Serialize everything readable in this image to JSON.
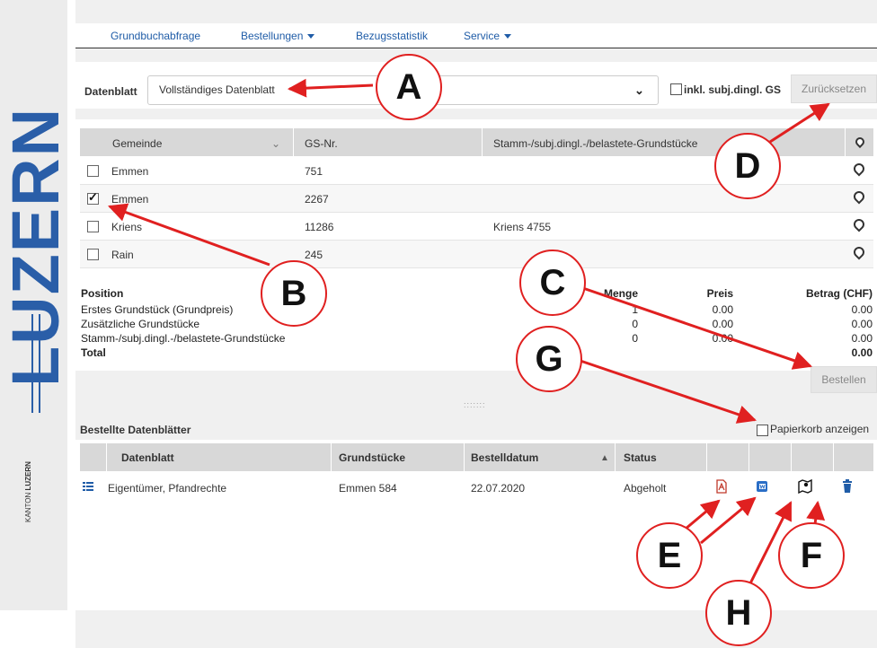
{
  "brand": {
    "word": "LUZERN",
    "small_top": "KANTON",
    "small_bottom": "LUZERN"
  },
  "nav": {
    "items": [
      {
        "label": "Grundbuchabfrage",
        "dropdown": false
      },
      {
        "label": "Bestellungen",
        "dropdown": true
      },
      {
        "label": "Bezugsstatistik",
        "dropdown": false
      },
      {
        "label": "Service",
        "dropdown": true
      }
    ]
  },
  "datenblatt": {
    "label": "Datenblatt",
    "selected": "Vollständiges Datenblatt",
    "checkbox_label": "inkl. subj.dingl. GS",
    "checkbox_checked": false,
    "reset_label": "Zurücksetzen"
  },
  "grundstuecke": {
    "columns": [
      "Gemeinde",
      "GS-Nr.",
      "Stamm-/subj.dingl.-/belastete-Grundstücke"
    ],
    "rows": [
      {
        "checked": false,
        "gemeinde": "Emmen",
        "gsnr": "751",
        "stamm": ""
      },
      {
        "checked": true,
        "gemeinde": "Emmen",
        "gsnr": "2267",
        "stamm": ""
      },
      {
        "checked": false,
        "gemeinde": "Kriens",
        "gsnr": "11286",
        "stamm": "Kriens 4755"
      },
      {
        "checked": false,
        "gemeinde": "Rain",
        "gsnr": "245",
        "stamm": ""
      }
    ]
  },
  "positions": {
    "headers": {
      "position": "Position",
      "menge": "Menge",
      "preis": "Preis",
      "betrag": "Betrag (CHF)"
    },
    "rows": [
      {
        "position": "Erstes Grundstück (Grundpreis)",
        "menge": "1",
        "preis": "0.00",
        "betrag": "0.00"
      },
      {
        "position": "Zusätzliche Grundstücke",
        "menge": "0",
        "preis": "0.00",
        "betrag": "0.00"
      },
      {
        "position": "Stamm-/subj.dingl.-/belastete-Grundstücke",
        "menge": "0",
        "preis": "0.00",
        "betrag": "0.00"
      }
    ],
    "total_label": "Total",
    "total_value": "0.00",
    "order_button": "Bestellen"
  },
  "splitter": ":::::::",
  "bestellte": {
    "title": "Bestellte Datenblätter",
    "trash_label": "Papierkorb anzeigen",
    "columns": [
      "Datenblatt",
      "Grundstücke",
      "Bestelldatum",
      "Status"
    ],
    "rows": [
      {
        "datenblatt": "Eigentümer, Pfandrechte",
        "grundstuecke": "Emmen 584",
        "datum": "22.07.2020",
        "status": "Abgeholt"
      }
    ]
  },
  "callouts": [
    "A",
    "B",
    "C",
    "D",
    "E",
    "F",
    "G",
    "H"
  ],
  "colors": {
    "link": "#1f5ca7",
    "brand": "#2a5ea8",
    "annotation": "#e02020"
  }
}
